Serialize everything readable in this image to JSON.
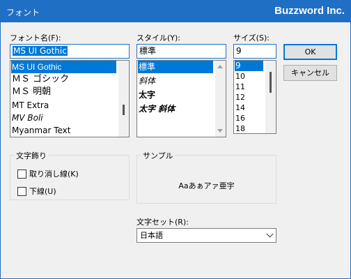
{
  "window": {
    "title": "フォント",
    "brand": "Buzzword Inc."
  },
  "font_name": {
    "label": "フォント名(F):",
    "value": "MS UI Gothic",
    "items": [
      "MS UI Gothic",
      "ＭＳ ゴシック",
      "ＭＳ 明朝",
      "MT Extra",
      "MV Boli",
      "Myanmar Text"
    ],
    "selected_index": 0
  },
  "style": {
    "label": "スタイル(Y):",
    "value": "標準",
    "items": [
      "標準",
      "斜体",
      "太字",
      "太字 斜体"
    ],
    "selected_index": 0
  },
  "size": {
    "label": "サイズ(S):",
    "value": "9",
    "items": [
      "9",
      "10",
      "11",
      "12",
      "14",
      "16",
      "18"
    ],
    "selected_index": 0
  },
  "buttons": {
    "ok": "OK",
    "cancel": "キャンセル"
  },
  "effects": {
    "title": "文字飾り",
    "strikeout": "取り消し線(K)",
    "underline": "下線(U)"
  },
  "sample": {
    "title": "サンプル",
    "text": "Aaあぁアァ亜宇"
  },
  "charset": {
    "label": "文字セット(R):",
    "value": "日本語"
  },
  "colors": {
    "title_bar": "#1f6fc5",
    "selection": "#0078d7",
    "dialog_bg": "#f0f0f0"
  }
}
